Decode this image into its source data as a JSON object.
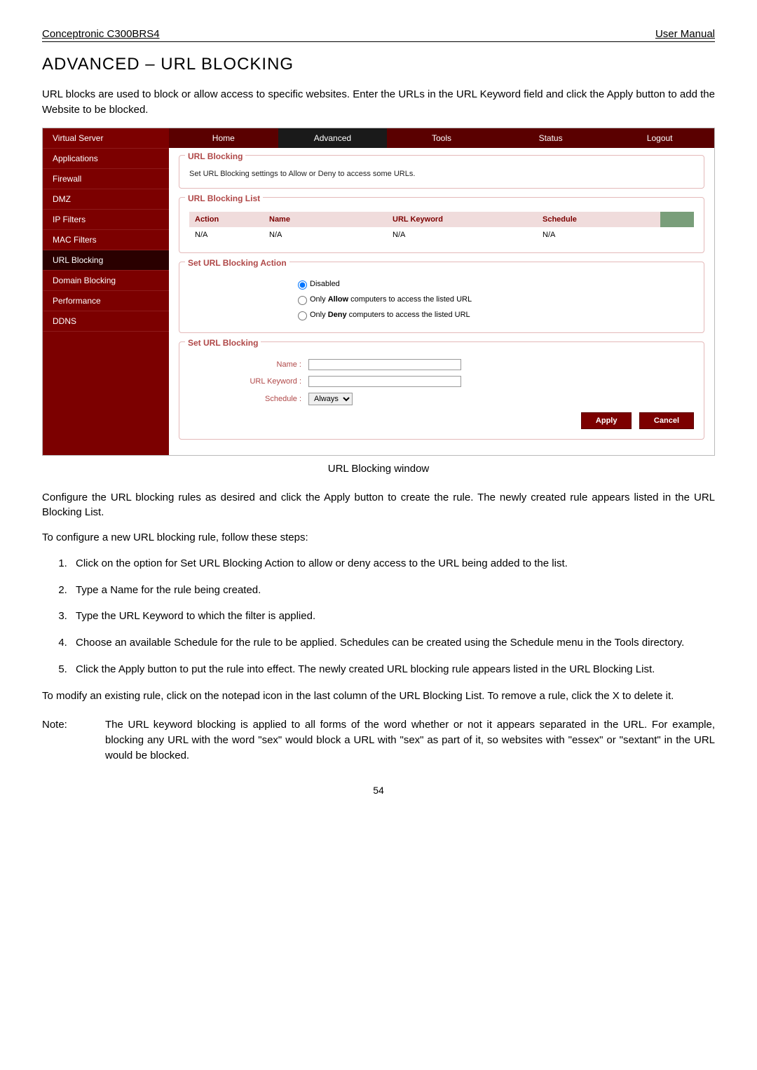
{
  "header": {
    "left": "Conceptronic C300BRS4",
    "right": "User Manual"
  },
  "title": "ADVANCED – URL BLOCKING",
  "intro": "URL blocks are used to block or allow access to specific websites. Enter the URLs in the URL Keyword field and click the Apply button to add the Website to be blocked.",
  "tabs": [
    "Home",
    "Advanced",
    "Tools",
    "Status",
    "Logout"
  ],
  "sidebar": [
    "Virtual Server",
    "Applications",
    "Firewall",
    "DMZ",
    "IP Filters",
    "MAC Filters",
    "URL Blocking",
    "Domain Blocking",
    "Performance",
    "DDNS"
  ],
  "urlblocking": {
    "legend": "URL Blocking",
    "desc": "Set URL Blocking settings to Allow or Deny to access some URLs."
  },
  "listlegend": "URL Blocking List",
  "cols": {
    "action": "Action",
    "name": "Name",
    "url": "URL Keyword",
    "schedule": "Schedule"
  },
  "row": {
    "action": "N/A",
    "name": "N/A",
    "url": "N/A",
    "schedule": "N/A"
  },
  "setaction": {
    "legend": "Set URL Blocking Action",
    "r1": "Disabled",
    "r2": "Only Allow computers to access the listed URL",
    "r3": "Only Deny computers to access the listed URL"
  },
  "setblock": {
    "legend": "Set URL Blocking",
    "name": "Name :",
    "keyword": "URL Keyword :",
    "schedule": "Schedule :",
    "select": "Always"
  },
  "buttons": {
    "apply": "Apply",
    "cancel": "Cancel"
  },
  "caption": "URL Blocking window",
  "p2": "Configure the URL blocking rules as desired and click the Apply button to create the rule. The newly created rule appears listed in the URL Blocking List.",
  "p3": "To configure a new URL blocking rule, follow these steps:",
  "steps": [
    "Click on the option for Set URL Blocking Action to allow or deny access to the URL being added to the list.",
    "Type a Name for the rule being created.",
    "Type the URL Keyword to which the filter is applied.",
    "Choose an available Schedule for the rule to be applied. Schedules can be created using the Schedule menu in the Tools directory.",
    "Click the Apply button to put the rule into effect. The newly created URL blocking rule appears listed in the URL Blocking List."
  ],
  "p4": "To modify an existing rule, click on the notepad icon in the last column of the URL Blocking List. To remove a rule, click the X to delete it.",
  "noteLabel": "Note:",
  "note": "The URL keyword blocking is applied to all forms of the word whether or not it appears separated in the URL. For example, blocking any URL with the word \"sex\" would block a URL with \"sex\" as part of it, so websites with \"essex\" or \"sextant\" in the URL would be blocked.",
  "pagenum": "54"
}
